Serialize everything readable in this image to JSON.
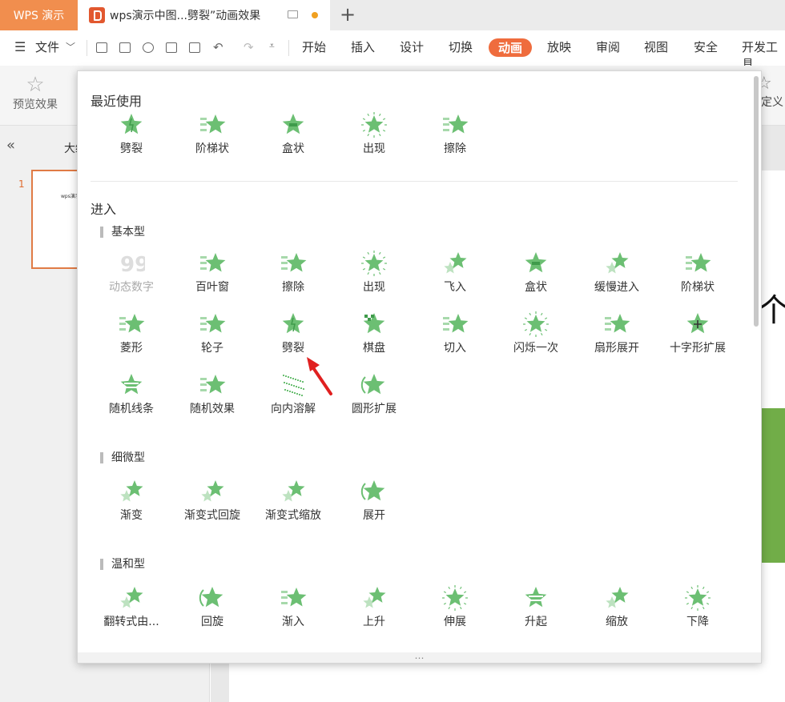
{
  "titlebar": {
    "app_tab": "WPS 演示",
    "doc_tab": "wps演示中图...劈裂”动画效果"
  },
  "menubar": {
    "file": "文件",
    "tabs": [
      "开始",
      "插入",
      "设计",
      "切换",
      "动画",
      "放映",
      "审阅",
      "视图",
      "安全",
      "开发工具"
    ],
    "active_tab": "动画"
  },
  "ribbon": {
    "preview": "预览效果",
    "custom": "自定义"
  },
  "left_panel": {
    "outline": "大纲",
    "slide_number": "1",
    "thumb_text": "wps演示"
  },
  "slide": {
    "char": "个"
  },
  "panel": {
    "recent_title": "最近使用",
    "recent": [
      {
        "label": "劈裂",
        "icon": "split-effect-icon",
        "shape": "split"
      },
      {
        "label": "阶梯状",
        "icon": "stairs-effect-icon",
        "shape": "lines"
      },
      {
        "label": "盒状",
        "icon": "box-effect-icon",
        "shape": "box"
      },
      {
        "label": "出现",
        "icon": "appear-effect-icon",
        "shape": "burst"
      },
      {
        "label": "擦除",
        "icon": "wipe-effect-icon",
        "shape": "lines"
      }
    ],
    "enter_title": "进入",
    "basic_title": "基本型",
    "basic": [
      {
        "label": "动态数字",
        "icon": "dynamic-number-icon",
        "shape": "num",
        "disabled": true
      },
      {
        "label": "百叶窗",
        "icon": "blinds-effect-icon",
        "shape": "lines"
      },
      {
        "label": "擦除",
        "icon": "wipe-effect-icon",
        "shape": "lines"
      },
      {
        "label": "出现",
        "icon": "appear-effect-icon",
        "shape": "burst"
      },
      {
        "label": "飞入",
        "icon": "fly-in-effect-icon",
        "shape": "fly"
      },
      {
        "label": "盒状",
        "icon": "box-effect-icon",
        "shape": "box"
      },
      {
        "label": "缓慢进入",
        "icon": "crawl-in-effect-icon",
        "shape": "fly"
      },
      {
        "label": "阶梯状",
        "icon": "stairs-effect-icon",
        "shape": "lines"
      },
      {
        "label": "菱形",
        "icon": "diamond-effect-icon",
        "shape": "lines"
      },
      {
        "label": "轮子",
        "icon": "wheel-effect-icon",
        "shape": "lines"
      },
      {
        "label": "劈裂",
        "icon": "split-effect-icon",
        "shape": "split"
      },
      {
        "label": "棋盘",
        "icon": "checkerboard-effect-icon",
        "shape": "check"
      },
      {
        "label": "切入",
        "icon": "peek-in-effect-icon",
        "shape": "lines"
      },
      {
        "label": "闪烁一次",
        "icon": "flash-once-effect-icon",
        "shape": "burst"
      },
      {
        "label": "扇形展开",
        "icon": "wedge-effect-icon",
        "shape": "lines"
      },
      {
        "label": "十字形扩展",
        "icon": "plus-effect-icon",
        "shape": "plus"
      },
      {
        "label": "随机线条",
        "icon": "random-bars-effect-icon",
        "shape": "bars"
      },
      {
        "label": "随机效果",
        "icon": "random-effect-icon",
        "shape": "lines"
      },
      {
        "label": "向内溶解",
        "icon": "dissolve-in-effect-icon",
        "shape": "dissolve"
      },
      {
        "label": "圆形扩展",
        "icon": "circle-effect-icon",
        "shape": "circle"
      }
    ],
    "subtle_title": "细微型",
    "subtle": [
      {
        "label": "渐变",
        "icon": "fade-effect-icon",
        "shape": "fade"
      },
      {
        "label": "渐变式回旋",
        "icon": "fade-swivel-effect-icon",
        "shape": "fade"
      },
      {
        "label": "渐变式缩放",
        "icon": "fade-zoom-effect-icon",
        "shape": "fade"
      },
      {
        "label": "展开",
        "icon": "expand-effect-icon",
        "shape": "circle"
      }
    ],
    "moderate_title": "温和型",
    "moderate": [
      {
        "label": "翻转式由...",
        "icon": "flip-effect-icon",
        "shape": "fade"
      },
      {
        "label": "回旋",
        "icon": "swivel-effect-icon",
        "shape": "circle"
      },
      {
        "label": "渐入",
        "icon": "ease-in-effect-icon",
        "shape": "lines"
      },
      {
        "label": "上升",
        "icon": "rise-up-effect-icon",
        "shape": "fly"
      },
      {
        "label": "伸展",
        "icon": "stretch-effect-icon",
        "shape": "burst"
      },
      {
        "label": "升起",
        "icon": "ascend-effect-icon",
        "shape": "bars"
      },
      {
        "label": "缩放",
        "icon": "zoom-effect-icon",
        "shape": "fly"
      },
      {
        "label": "下降",
        "icon": "descend-effect-icon",
        "shape": "burst"
      }
    ],
    "more": "…"
  },
  "colors": {
    "accent": "#ef6c3d",
    "star": "#6cbf73",
    "star_dark": "#3f9b4b"
  }
}
